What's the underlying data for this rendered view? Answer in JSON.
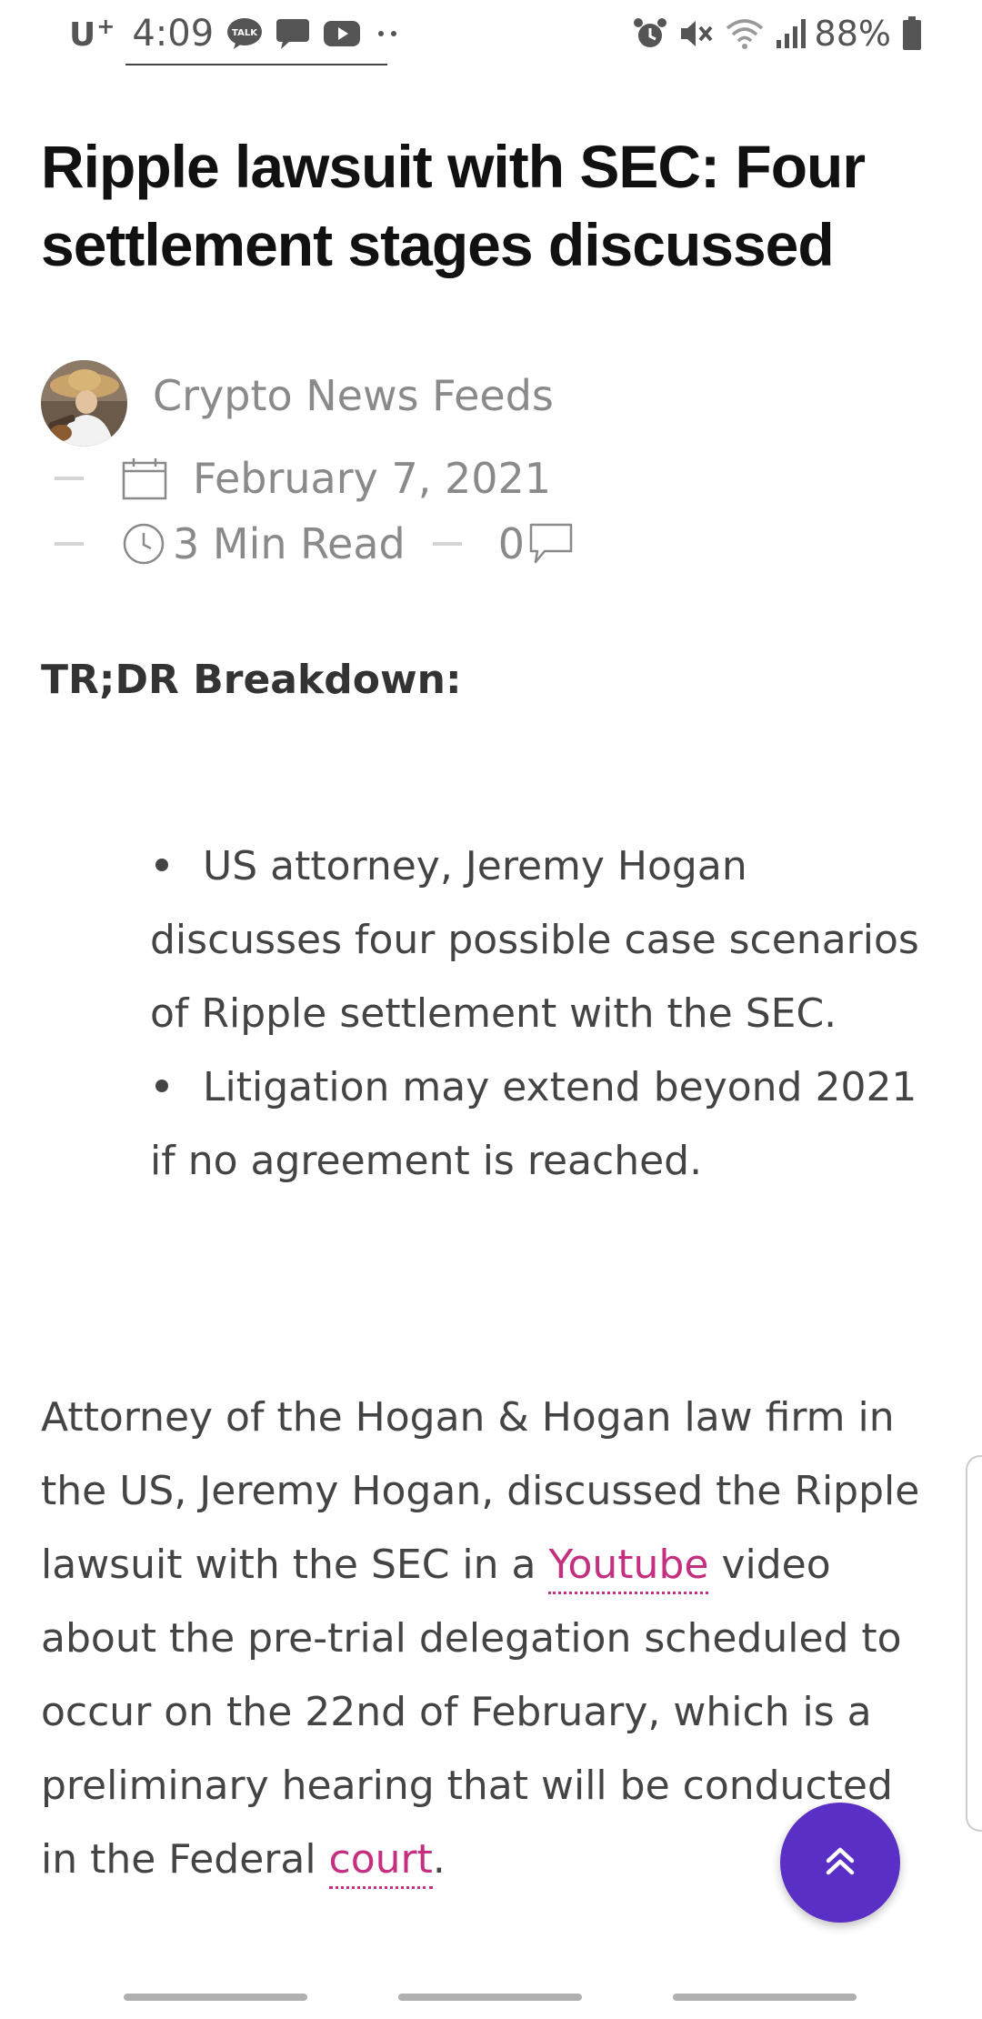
{
  "status_bar": {
    "carrier": "U",
    "carrier_sup": "+",
    "time": "4:09",
    "notification_icons": [
      "talk-icon",
      "chat-bubble-icon",
      "youtube-icon",
      "more-dots-icon"
    ],
    "system_icons": [
      "alarm-icon",
      "mute-icon",
      "wifi-icon",
      "signal-icon"
    ],
    "battery_percent": "88%"
  },
  "article": {
    "title": "Ripple lawsuit with SEC: Four settlement stages discussed",
    "author": "Crypto News Feeds",
    "date": "February 7, 2021",
    "read_time": "3 Min Read",
    "comment_count": "0",
    "tldr_heading": "TR;DR Breakdown:",
    "bullets": [
      "US attorney, Jeremy Hogan discusses four possible case scenarios of Ripple settlement with the SEC.",
      "Litigation may extend beyond 2021 if no agreement is reached."
    ],
    "paragraph": {
      "part1": "Attorney of the Hogan & Hogan law firm in the US, Jeremy Hogan, discussed the Ripple lawsuit with the SEC in a ",
      "link1": "Youtube",
      "part2": " video about the pre-trial delegation scheduled to occur on the 22nd of February, which is a preliminary hearing that will be conducted in the Federal ",
      "link2": "court",
      "part3": "."
    }
  },
  "colors": {
    "link": "#c4307f",
    "fab": "#5a2fc6",
    "title": "#111111",
    "meta": "#8a8a8a",
    "body": "#444444"
  },
  "fab": {
    "icon": "double-chevron-up-icon"
  }
}
